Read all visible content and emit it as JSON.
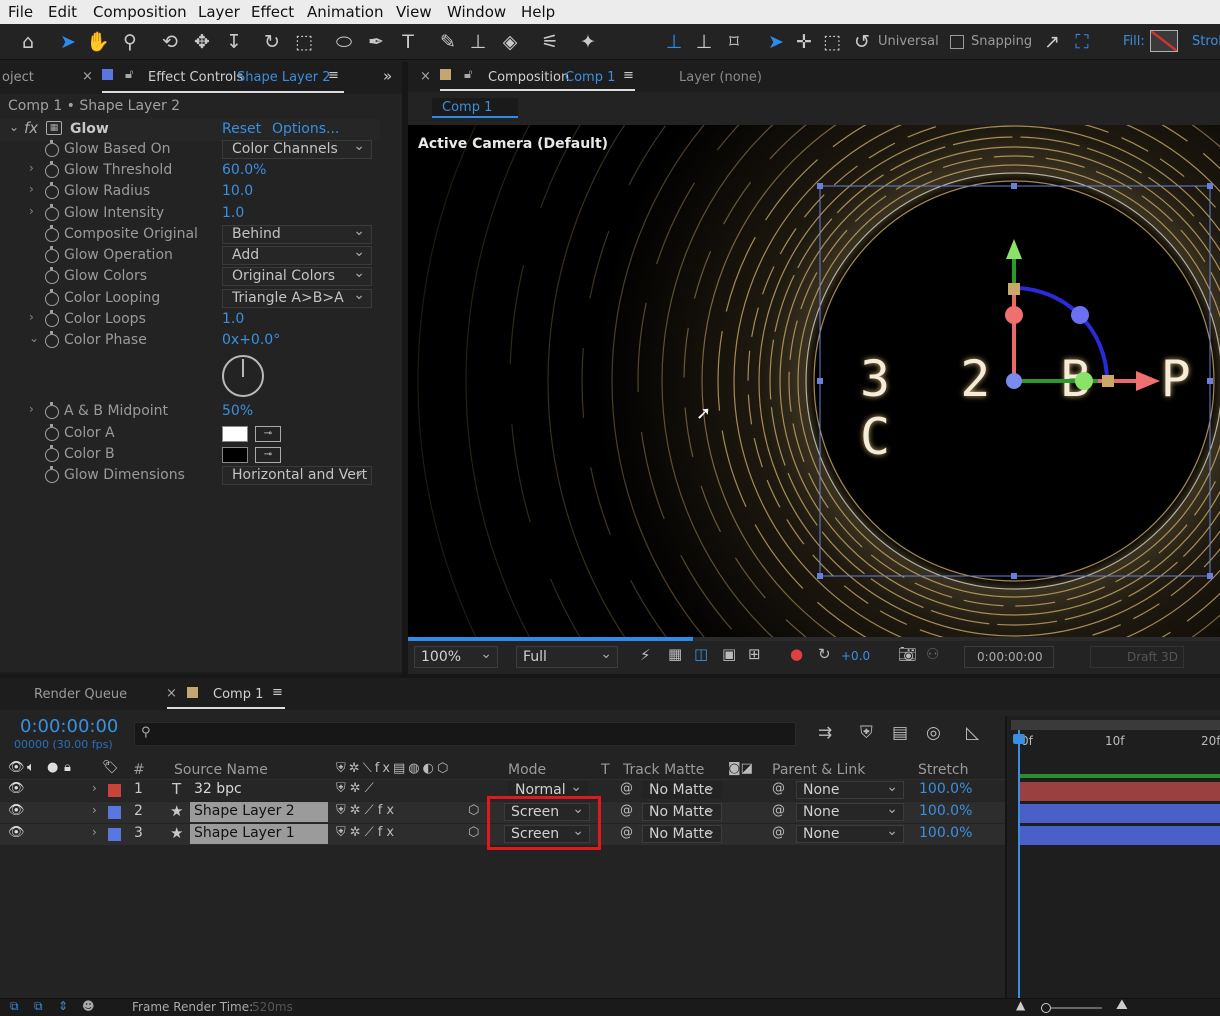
{
  "menu": [
    "File",
    "Edit",
    "Composition",
    "Layer",
    "Effect",
    "Animation",
    "View",
    "Window",
    "Help"
  ],
  "toolbar": {
    "universal": "Universal",
    "snapping": "Snapping",
    "fill": "Fill:",
    "stroke": "Strok"
  },
  "effect_panel": {
    "project_tab": "oject",
    "tab_prefix": "Effect Controls",
    "tab_layer": "Shape Layer 2",
    "breadcrumb": "Comp 1 • Shape Layer 2",
    "effect_name": "Glow",
    "reset": "Reset",
    "options": "Options...",
    "props": [
      {
        "name": "Glow Based On",
        "value": "Color Channels"
      },
      {
        "name": "Glow Threshold",
        "value": "60.0%"
      },
      {
        "name": "Glow Radius",
        "value": "10.0"
      },
      {
        "name": "Glow Intensity",
        "value": "1.0"
      },
      {
        "name": "Composite Original",
        "value": "Behind"
      },
      {
        "name": "Glow Operation",
        "value": "Add"
      },
      {
        "name": "Glow Colors",
        "value": "Original Colors"
      },
      {
        "name": "Color Looping",
        "value": "Triangle A>B>A"
      },
      {
        "name": "Color Loops",
        "value": "1.0"
      },
      {
        "name": "Color Phase",
        "value": "0x+0.0°"
      },
      {
        "name": "A & B Midpoint",
        "value": "50%"
      },
      {
        "name": "Color A",
        "value": ""
      },
      {
        "name": "Color B",
        "value": ""
      },
      {
        "name": "Glow Dimensions",
        "value": "Horizontal and Vert"
      }
    ]
  },
  "comp_panel": {
    "tab_prefix": "Composition",
    "tab_comp": "Comp 1",
    "layer_tab": "Layer (none)",
    "subtab": "Comp 1",
    "camera_label": "Active Camera (Default)",
    "viewer_text": "3 2 B P C",
    "footer": {
      "zoom": "100%",
      "resolution": "Full",
      "exposure": "+0.0",
      "timecode": "0:00:00:00",
      "draft3d": "Draft 3D"
    }
  },
  "timeline": {
    "tab_render": "Render Queue",
    "tab_comp": "Comp 1",
    "timecode": "0:00:00:00",
    "frame_info": "00000 (30.00 fps)",
    "search_placeholder": "",
    "columns": {
      "num": "#",
      "source": "Source Name",
      "mode": "Mode",
      "t": "T",
      "trackmatte": "Track Matte",
      "parent": "Parent & Link",
      "stretch": "Stretch"
    },
    "ruler": [
      "0f",
      "10f",
      "20f"
    ],
    "layers": [
      {
        "num": "1",
        "type": "T",
        "name": "32 bpc",
        "mode": "Normal",
        "matte": "No Matte",
        "parent": "None",
        "stretch": "100.0%",
        "color": "#c8443a"
      },
      {
        "num": "2",
        "type": "★",
        "name": "Shape Layer 2",
        "mode": "Screen",
        "matte": "No Matte",
        "parent": "None",
        "stretch": "100.0%",
        "color": "#5a77e0"
      },
      {
        "num": "3",
        "type": "★",
        "name": "Shape Layer 1",
        "mode": "Screen",
        "matte": "No Matte",
        "parent": "None",
        "stretch": "100.0%",
        "color": "#5a77e0"
      }
    ],
    "status": "Frame Render Time:",
    "status_value": "520ms"
  },
  "colors": {
    "accent": "#2d8ceb",
    "highlight_box": "#e0191f",
    "layer1": "#c8443a",
    "shape": "#5a77e0"
  }
}
